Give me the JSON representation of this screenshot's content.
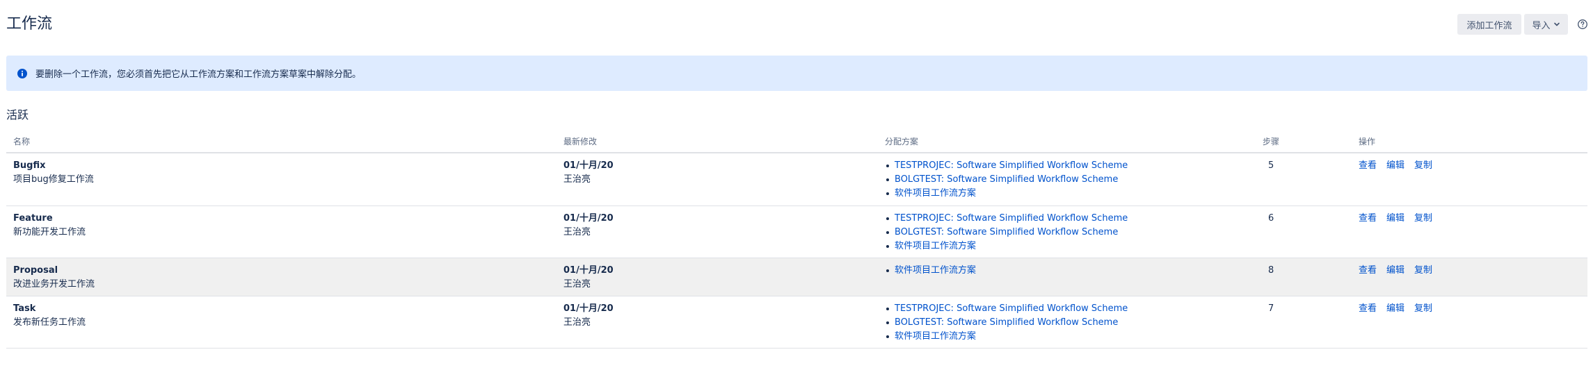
{
  "header": {
    "title": "工作流",
    "add_label": "添加工作流",
    "import_label": "导入"
  },
  "banner": {
    "text": "要删除一个工作流，您必须首先把它从工作流方案和工作流方案草案中解除分配。"
  },
  "section": {
    "active_title": "活跃"
  },
  "columns": {
    "name": "名称",
    "modified": "最新修改",
    "schemes": "分配方案",
    "steps": "步骤",
    "actions": "操作"
  },
  "actions": {
    "view": "查看",
    "edit": "编辑",
    "copy": "复制"
  },
  "rows": [
    {
      "name": "Bugfix",
      "desc": "项目bug修复工作流",
      "date": "01/十月/20",
      "author": "王治亮",
      "schemes": [
        "TESTPROJEC: Software Simplified Workflow Scheme",
        "BOLGTEST: Software Simplified Workflow Scheme",
        "软件项目工作流方案"
      ],
      "steps": "5"
    },
    {
      "name": "Feature",
      "desc": "新功能开发工作流",
      "date": "01/十月/20",
      "author": "王治亮",
      "schemes": [
        "TESTPROJEC: Software Simplified Workflow Scheme",
        "BOLGTEST: Software Simplified Workflow Scheme",
        "软件项目工作流方案"
      ],
      "steps": "6"
    },
    {
      "name": "Proposal",
      "desc": "改进业务开发工作流",
      "date": "01/十月/20",
      "author": "王治亮",
      "schemes": [
        "软件项目工作流方案"
      ],
      "steps": "8"
    },
    {
      "name": "Task",
      "desc": "发布新任务工作流",
      "date": "01/十月/20",
      "author": "王治亮",
      "schemes": [
        "TESTPROJEC: Software Simplified Workflow Scheme",
        "BOLGTEST: Software Simplified Workflow Scheme",
        "软件项目工作流方案"
      ],
      "steps": "7"
    }
  ],
  "footer_fragment": "…",
  "colors": {
    "banner_bg": "#deebff",
    "banner_icon": "#0052cc",
    "link": "#0052cc",
    "highlight_row": "#f0f0f0",
    "button_bg": "#ebecf0"
  },
  "icons": {
    "help": "question-circle-icon",
    "info": "info-circle-icon",
    "dropdown": "chevron-down-icon"
  }
}
